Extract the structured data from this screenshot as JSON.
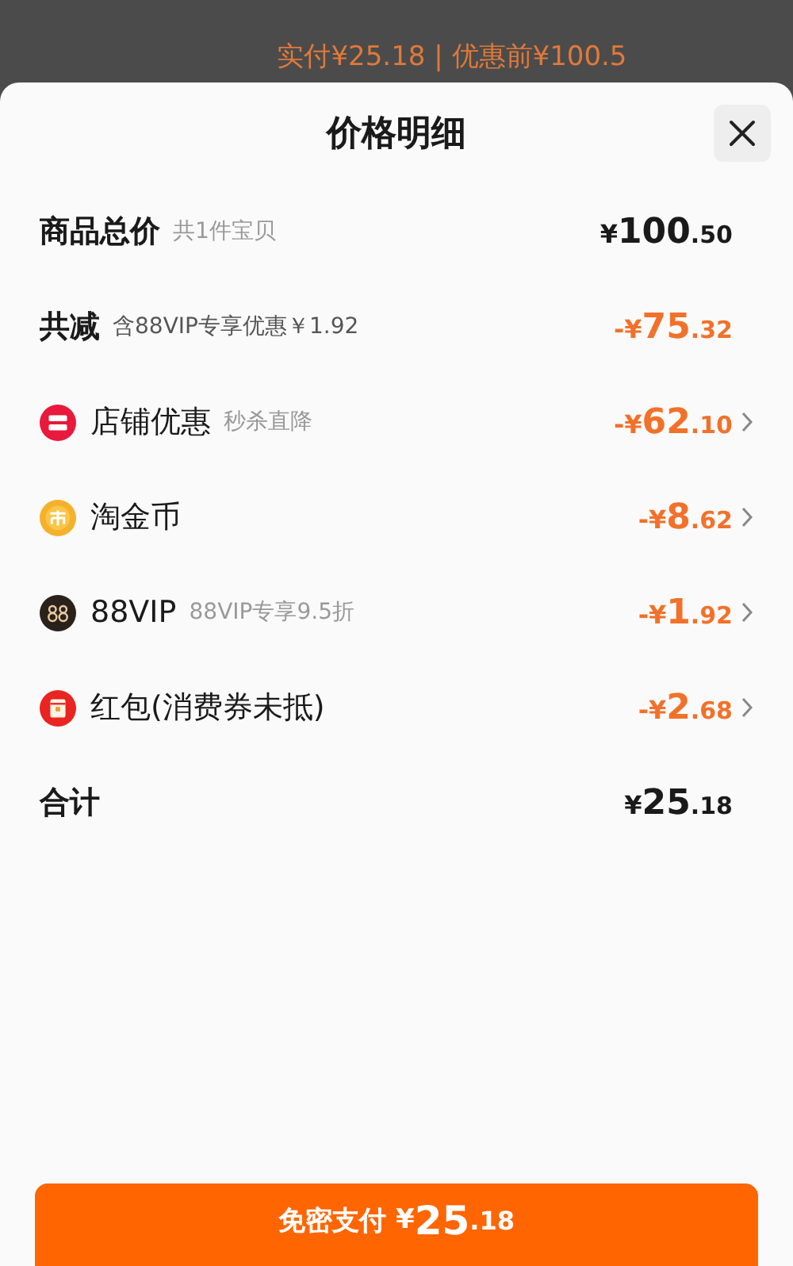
{
  "background_summary": "实付¥25.18 | 优惠前¥100.5",
  "sheet": {
    "title": "价格明细"
  },
  "rows": [
    {
      "kind": "total",
      "label": "商品总价",
      "note": "共1件宝贝",
      "amount": "¥100.50"
    },
    {
      "kind": "discount",
      "label": "共减",
      "note": "含88VIP专享优惠￥1.92",
      "amount": "-¥75.32"
    },
    {
      "kind": "shop",
      "label": "店铺优惠",
      "note": "秒杀直降",
      "amount": "-¥62.10"
    },
    {
      "kind": "coin",
      "label": "淘金币",
      "amount": "-¥8.62"
    },
    {
      "kind": "vip",
      "label": "88VIP",
      "note": "88VIP专享9.5折",
      "amount": "-¥1.92"
    },
    {
      "kind": "redpacket",
      "label": "红包(消费券未抵)",
      "amount": "-¥2.68"
    },
    {
      "kind": "sum",
      "label": "合计",
      "amount": "¥25.18"
    }
  ],
  "pay_button": {
    "label": "免密支付",
    "amount": "¥25.18"
  }
}
